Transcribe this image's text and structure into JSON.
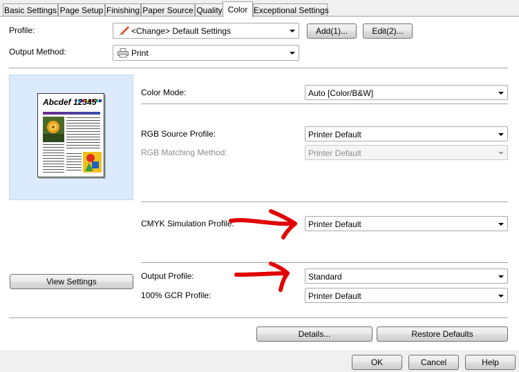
{
  "tabs": [
    {
      "label": "Basic Settings"
    },
    {
      "label": "Page Setup"
    },
    {
      "label": "Finishing"
    },
    {
      "label": "Paper Source"
    },
    {
      "label": "Quality"
    },
    {
      "label": "Color"
    },
    {
      "label": "Exceptional Settings"
    }
  ],
  "active_tab": "Color",
  "profile": {
    "label": "Profile:",
    "value": "<Change> Default Settings",
    "add_label": "Add(1)...",
    "edit_label": "Edit(2)..."
  },
  "output_method": {
    "label": "Output Method:",
    "value": "Print"
  },
  "preview": {
    "title": "Abcdef 12345",
    "view_settings_label": "View Settings"
  },
  "color_settings": {
    "color_mode": {
      "label": "Color Mode:",
      "value": "Auto [Color/B&W]"
    },
    "rgb_source_profile": {
      "label": "RGB Source Profile:",
      "value": "Printer Default"
    },
    "rgb_matching_method": {
      "label": "RGB Matching Method:",
      "value": "Printer Default",
      "disabled": true
    },
    "cmyk_simulation_profile": {
      "label": "CMYK Simulation Profile:",
      "value": "Printer Default"
    },
    "output_profile": {
      "label": "Output Profile:",
      "value": "Standard"
    },
    "gcr_profile": {
      "label": "100% GCR Profile:",
      "value": "Printer Default"
    }
  },
  "details_label": "Details...",
  "restore_defaults_label": "Restore Defaults",
  "dialog_buttons": {
    "ok": "OK",
    "cancel": "Cancel",
    "help": "Help"
  },
  "annotation_color": "#e00000"
}
